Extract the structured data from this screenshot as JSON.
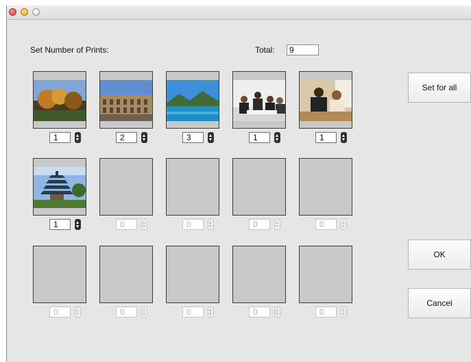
{
  "labels": {
    "set_number": "Set Number of Prints:",
    "total": "Total:"
  },
  "total_value": "9",
  "buttons": {
    "set_for_all": "Set for all",
    "ok": "OK",
    "cancel": "Cancel"
  },
  "slots": [
    {
      "qty": "1",
      "photo": "autumn-park"
    },
    {
      "qty": "2",
      "photo": "colosseum"
    },
    {
      "qty": "3",
      "photo": "mountain-lake"
    },
    {
      "qty": "1",
      "photo": "business-meeting"
    },
    {
      "qty": "1",
      "photo": "office-workers"
    },
    {
      "qty": "1",
      "photo": "pagoda"
    },
    {
      "qty": "0",
      "photo": ""
    },
    {
      "qty": "0",
      "photo": ""
    },
    {
      "qty": "0",
      "photo": ""
    },
    {
      "qty": "0",
      "photo": ""
    },
    {
      "qty": "0",
      "photo": ""
    },
    {
      "qty": "0",
      "photo": ""
    },
    {
      "qty": "0",
      "photo": ""
    },
    {
      "qty": "0",
      "photo": ""
    },
    {
      "qty": "0",
      "photo": ""
    }
  ]
}
